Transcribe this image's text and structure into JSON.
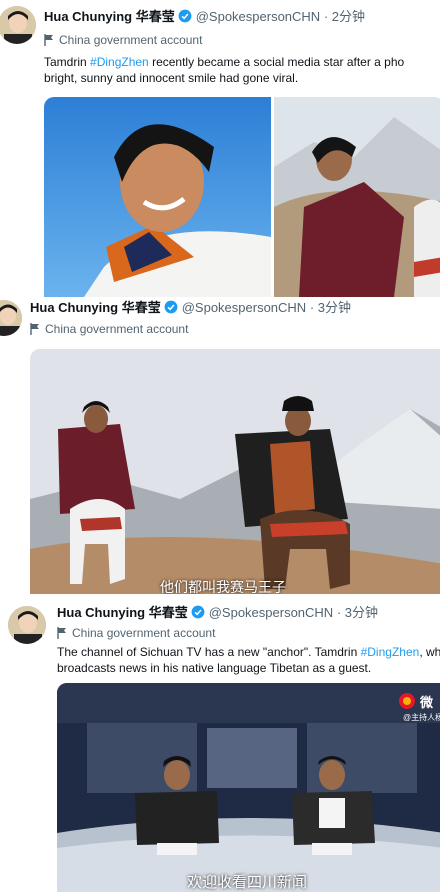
{
  "tweets": [
    {
      "name": "Hua Chunying 华春莹",
      "handle": "@SpokespersonCHN",
      "time": "2分钟",
      "label": "China government account",
      "text_line1_pre": "Tamdrin ",
      "text_line1_tag": "#DingZhen",
      "text_line1_post": " recently became a social media star after a pho",
      "text_line2": "bright, sunny and innocent smile had gone viral."
    },
    {
      "name": "Hua Chunying 华春莹",
      "handle": "@SpokespersonCHN",
      "time": "3分钟",
      "label": "China government account",
      "video_caption": "他们都叫我赛马王子"
    },
    {
      "name": "Hua Chunying 华春莹",
      "handle": "@SpokespersonCHN",
      "time": "3分钟",
      "label": "China government account",
      "text_line1_pre": "The channel of Sichuan TV has a new \"anchor\". Tamdrin ",
      "text_line1_tag": "#DingZhen",
      "text_line1_post": ", who",
      "text_line2": "broadcasts news in his native language Tibetan as a guest.",
      "video_caption": "欢迎收看四川新闻",
      "watermark_brand": "微",
      "watermark_sub": "@主持人杨"
    }
  ],
  "colors": {
    "accent": "#1d9bf0",
    "text": "#0f1419",
    "secondary": "#536471"
  }
}
